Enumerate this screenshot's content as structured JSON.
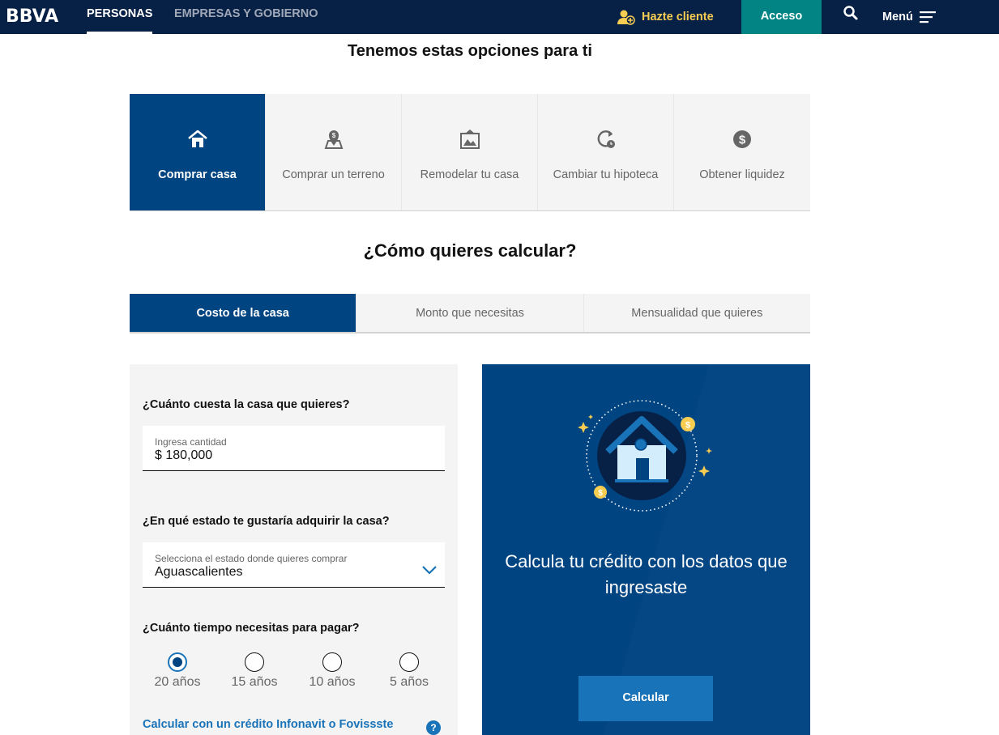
{
  "header": {
    "logo_text": "BBVA",
    "nav": [
      {
        "label": "PERSONAS",
        "active": true
      },
      {
        "label": "EMPRESAS Y GOBIERNO",
        "active": false
      }
    ],
    "hazte_cliente": "Hazte cliente",
    "acceso": "Acceso",
    "menu": "Menú",
    "icons": {
      "hazte": "user-add-icon",
      "search": "search-icon",
      "menu": "hamburger-icon"
    }
  },
  "options": {
    "title": "Tenemos estas opciones para ti",
    "items": [
      {
        "label": "Comprar casa",
        "icon": "house-icon",
        "active": true
      },
      {
        "label": "Comprar un terreno",
        "icon": "map-pin-dollar-icon",
        "active": false
      },
      {
        "label": "Remodelar tu casa",
        "icon": "picture-frame-icon",
        "active": false
      },
      {
        "label": "Cambiar tu hipoteca",
        "icon": "refresh-clock-icon",
        "active": false
      },
      {
        "label": "Obtener liquidez",
        "icon": "dollar-coin-icon",
        "active": false
      }
    ]
  },
  "calculator": {
    "title": "¿Cómo quieres calcular?",
    "tabs": [
      {
        "label": "Costo de la casa",
        "active": true
      },
      {
        "label": "Monto que necesitas",
        "active": false
      },
      {
        "label": "Mensualidad que quieres",
        "active": false
      }
    ]
  },
  "form": {
    "q1": "¿Cuánto cuesta la casa que quieres?",
    "price_field": {
      "label": "Ingresa cantidad",
      "value": "$ 180,000"
    },
    "q2": "¿En qué estado te gustaría adquirir la casa?",
    "state_field": {
      "label": "Selecciona el estado donde quieres comprar",
      "value": "Aguascalientes"
    },
    "q3": "¿Cuánto tiempo necesitas para pagar?",
    "terms": [
      {
        "label": "20 años",
        "selected": true
      },
      {
        "label": "15 años",
        "selected": false
      },
      {
        "label": "10 años",
        "selected": false
      },
      {
        "label": "5 años",
        "selected": false
      }
    ],
    "infonavit_link": "Calcular con un crédito Infonavit o Fovissste",
    "help": "?"
  },
  "result": {
    "text": "Calcula tu crédito con los datos que ingresaste",
    "button": "Calcular",
    "illustration": "house-coins-illustration"
  },
  "colors": {
    "navy": "#072146",
    "core_blue": "#004481",
    "medium_blue": "#1973b8",
    "aqua": "#028484",
    "yellow": "#f8cd51",
    "light_bg": "#f4f4f4"
  }
}
